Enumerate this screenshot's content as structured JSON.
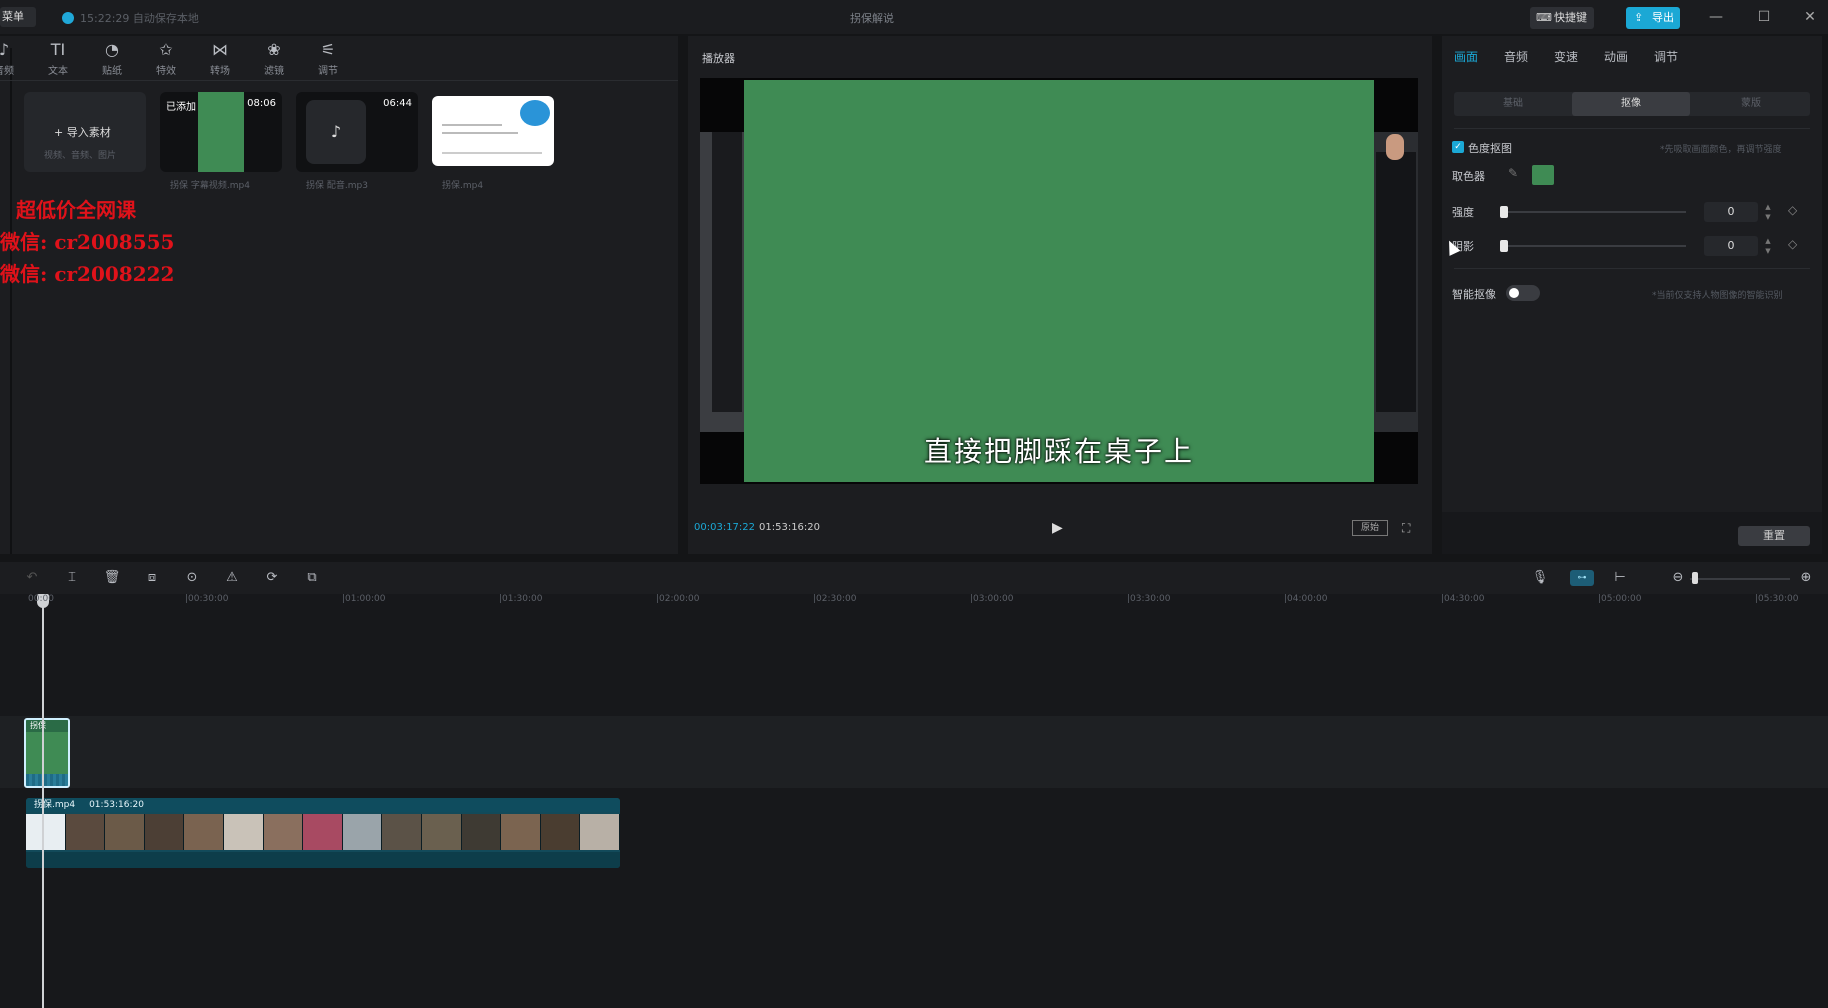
{
  "titlebar": {
    "menu_label": "菜单",
    "save_status": "15:22:29 自动保存本地",
    "doc_title": "拐保解说",
    "shortcut_label": "快捷键",
    "export_label": "导出",
    "minimize": "—",
    "maximize": "☐",
    "close": "✕"
  },
  "media_tabs": [
    {
      "label": "音频",
      "icon": "audio-icon",
      "glyph": "♪"
    },
    {
      "label": "文本",
      "icon": "text-icon",
      "glyph": "TI"
    },
    {
      "label": "贴纸",
      "icon": "sticker-icon",
      "glyph": "◔"
    },
    {
      "label": "特效",
      "icon": "effects-icon",
      "glyph": "✩"
    },
    {
      "label": "转场",
      "icon": "transition-icon",
      "glyph": "⋈"
    },
    {
      "label": "滤镜",
      "icon": "filter-icon",
      "glyph": "❀"
    },
    {
      "label": "调节",
      "icon": "adjust-icon",
      "glyph": "⚟"
    }
  ],
  "media": {
    "import_label": "+ 导入素材",
    "import_hint": "视频、音频、图片",
    "items": [
      {
        "tag": "已添加",
        "duration": "08:06",
        "name": "拐保 字幕视频.mp4"
      },
      {
        "tag": "",
        "duration": "06:44",
        "name": "拐保 配音.mp3"
      },
      {
        "tag": "",
        "duration": "",
        "name": "拐保.mp4"
      }
    ]
  },
  "watermark": {
    "line1": "超低价全网课",
    "line2": "微信: cr2008555",
    "line3": "微信: cr2008222"
  },
  "player": {
    "title": "播放器",
    "subtitle": "直接把脚踩在桌子上",
    "current_time": "00:03:17:22",
    "total_time": "01:53:16:20",
    "ratio_label": "原始",
    "play_icon": "▶",
    "fullscreen_icon": "⛶"
  },
  "inspector": {
    "tabs": [
      "画面",
      "音频",
      "变速",
      "动画",
      "调节"
    ],
    "active_tab": "画面",
    "sub_tabs": [
      "基础",
      "抠像",
      "蒙版"
    ],
    "active_sub_tab": "抠像",
    "chroma_key_label": "色度抠图",
    "chroma_key_hint": "*先吸取画面颜色，再调节强度",
    "picker_label": "取色器",
    "picked_color": "#3f8b54",
    "strength_label": "强度",
    "strength_value": "0",
    "shadow_label": "阴影",
    "shadow_value": "0",
    "smart_cutout_label": "智能抠像",
    "smart_cutout_hint": "*当前仅支持人物图像的智能识别",
    "smart_cutout_enabled": false,
    "reset_label": "重置"
  },
  "timeline": {
    "toolbar_icons": [
      "undo-icon",
      "split-icon",
      "delete-icon",
      "freeze-icon",
      "play-region-icon",
      "mirror-icon",
      "rotate-icon",
      "crop-icon"
    ],
    "toolbar_glyphs": [
      "↶",
      "⌶",
      "🗑",
      "⧈",
      "⊙",
      "⚠",
      "⟳",
      "⧉"
    ],
    "right_icons": [
      "mic-icon",
      "link-icon",
      "split-view-icon",
      "zoom-out-icon",
      "zoom-in-icon"
    ],
    "right_glyphs": [
      "🎙",
      "⊶",
      "⊢",
      "⊖",
      "⊕"
    ],
    "ruler": [
      "00:00",
      "|00:30:00",
      "|01:00:00",
      "|01:30:00",
      "|02:00:00",
      "|02:30:00",
      "|03:00:00",
      "|03:30:00",
      "|04:00:00",
      "|04:30:00",
      "|05:00:00",
      "|05:30:00"
    ],
    "overlay_clip_label": "拐保",
    "main_clip_name": "拐保.mp4",
    "main_clip_duration": "01:53:16:20"
  }
}
